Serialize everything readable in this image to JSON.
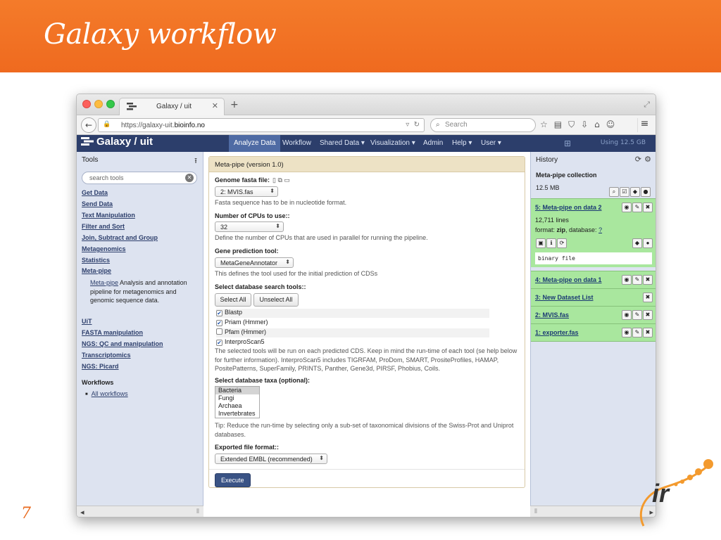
{
  "slide": {
    "title": "Galaxy workflow",
    "number": "7"
  },
  "browser": {
    "tab_title": "Galaxy / uit",
    "url_prefix": "https://galaxy-uit.",
    "url_host": "bioinfo.no",
    "search_placeholder": "Search"
  },
  "masthead": {
    "brand": "Galaxy / uit",
    "items": [
      "Analyze Data",
      "Workflow",
      "Shared Data ▾",
      "Visualization ▾",
      "Admin",
      "Help ▾",
      "User ▾"
    ],
    "right": "Using 12.5 GB"
  },
  "tools": {
    "header": "Tools",
    "search_placeholder": "search tools",
    "links": [
      "Get Data",
      "Send Data",
      "Text Manipulation",
      "Filter and Sort",
      "Join, Subtract and Group",
      "Metagenomics",
      "Statistics",
      "Meta-pipe"
    ],
    "metapipe_link": "Meta-pipe",
    "metapipe_desc": " Analysis and annotation pipeline for metagenomics and genomic sequence data.",
    "links2": [
      "UiT",
      "FASTA manipulation",
      "NGS: QC and manipulation",
      "Transcriptomics",
      "NGS: Picard"
    ],
    "workflows_header": "Workflows",
    "all_workflows": "All workflows"
  },
  "form": {
    "title": "Meta-pipe (version 1.0)",
    "genome_label": "Genome fasta file:",
    "genome_value": "2: MVIS.fas",
    "genome_help": "Fasta sequence has to be in nucleotide format.",
    "cpu_label": "Number of CPUs to use::",
    "cpu_value": "32",
    "cpu_help": "Define the number of CPUs that are used in parallel for running the pipeline.",
    "gene_label": "Gene prediction tool:",
    "gene_value": "MetaGeneAnnotator",
    "gene_help": "This defines the tool used for the initial prediction of CDSs",
    "db_label": "Select database search tools::",
    "select_all": "Select All",
    "unselect_all": "Unselect All",
    "db_tools": [
      {
        "label": "Blastp",
        "checked": "✔"
      },
      {
        "label": "Priam (Hmmer)",
        "checked": "✔"
      },
      {
        "label": "Pfam (Hmmer)",
        "checked": ""
      },
      {
        "label": "InterproScan5",
        "checked": "✔"
      }
    ],
    "db_help": "The selected tools will be run on each predicted CDS. Keep in mind the run-time of each tool (se help below for further information). InterproScan5 includes TIGRFAM, ProDom, SMART, PrositeProfiles, HAMAP, PositePatterns, SuperFamily, PRINTS, Panther, Gene3d, PIRSF, Phobius, Coils.",
    "taxa_label": "Select database taxa (optional):",
    "taxa": [
      "Bacteria",
      "Fungi",
      "Archaea",
      "Invertebrates"
    ],
    "taxa_help": "Tip: Reduce the run-time by selecting only a sub-set of taxonomical divisions of the Swiss-Prot and Uniprot databases.",
    "format_label": "Exported file format::",
    "format_value": "Extended EMBL (recommended)",
    "execute": "Execute"
  },
  "history": {
    "header": "History",
    "name": "Meta-pipe collection",
    "size": "12.5 MB",
    "datasets": [
      {
        "name": "5: Meta-pipe on data 2",
        "lines": "12,711 lines",
        "format_prefix": "format: ",
        "format": "zip",
        "db_prefix": ", database: ",
        "db": "?",
        "peek": "binary file"
      },
      {
        "name": "4: Meta-pipe on data 1"
      },
      {
        "name": "3: New Dataset List"
      },
      {
        "name": "2: MVIS.fas"
      },
      {
        "name": "1: exporter.fas"
      }
    ]
  },
  "colors": {
    "slide_accent": "#ef6a1f",
    "masthead": "#2c3e6b",
    "dataset_ok": "#a9e79e",
    "execute": "#3a5385"
  }
}
